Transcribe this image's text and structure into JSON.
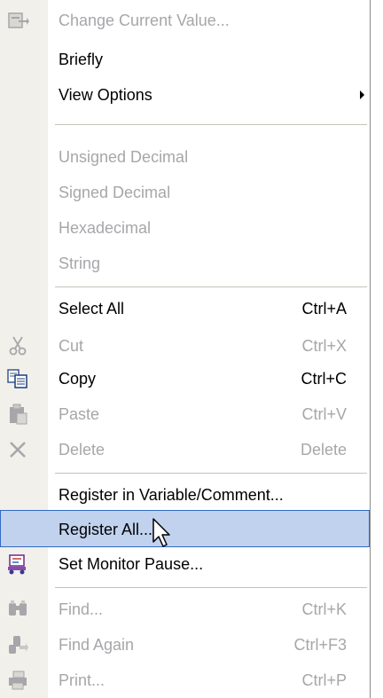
{
  "menu": {
    "items": [
      {
        "label": "Change Current Value...",
        "shortcut": "",
        "disabled": true,
        "icon": "change-value-icon"
      },
      {
        "label": "Briefly",
        "shortcut": "",
        "disabled": false,
        "icon": ""
      },
      {
        "label": "View Options",
        "shortcut": "",
        "disabled": false,
        "icon": "",
        "submenu": true
      },
      {
        "label": "Unsigned Decimal",
        "shortcut": "",
        "disabled": true,
        "icon": ""
      },
      {
        "label": "Signed Decimal",
        "shortcut": "",
        "disabled": true,
        "icon": ""
      },
      {
        "label": "Hexadecimal",
        "shortcut": "",
        "disabled": true,
        "icon": ""
      },
      {
        "label": "String",
        "shortcut": "",
        "disabled": true,
        "icon": ""
      },
      {
        "label": "Select All",
        "shortcut": "Ctrl+A",
        "disabled": false,
        "icon": ""
      },
      {
        "label": "Cut",
        "shortcut": "Ctrl+X",
        "disabled": true,
        "icon": "scissors-icon"
      },
      {
        "label": "Copy",
        "shortcut": "Ctrl+C",
        "disabled": false,
        "icon": "copy-icon"
      },
      {
        "label": "Paste",
        "shortcut": "Ctrl+V",
        "disabled": true,
        "icon": "paste-icon"
      },
      {
        "label": "Delete",
        "shortcut": "Delete",
        "disabled": true,
        "icon": "delete-x-icon"
      },
      {
        "label": "Register in Variable/Comment...",
        "shortcut": "",
        "disabled": false,
        "icon": ""
      },
      {
        "label": "Register All...",
        "shortcut": "",
        "disabled": false,
        "icon": "",
        "selected": true
      },
      {
        "label": "Set Monitor Pause...",
        "shortcut": "",
        "disabled": false,
        "icon": "monitor-pause-icon"
      },
      {
        "label": "Find...",
        "shortcut": "Ctrl+K",
        "disabled": true,
        "icon": "binoculars-icon"
      },
      {
        "label": "Find Again",
        "shortcut": "Ctrl+F3",
        "disabled": true,
        "icon": "find-again-icon"
      },
      {
        "label": "Print...",
        "shortcut": "Ctrl+P",
        "disabled": true,
        "icon": "printer-icon"
      }
    ]
  },
  "colors": {
    "selection_bg": "#c1d2ee",
    "selection_border": "#316ac5",
    "disabled_text": "#a7a6aa",
    "gutter": "#f1f0ea"
  }
}
